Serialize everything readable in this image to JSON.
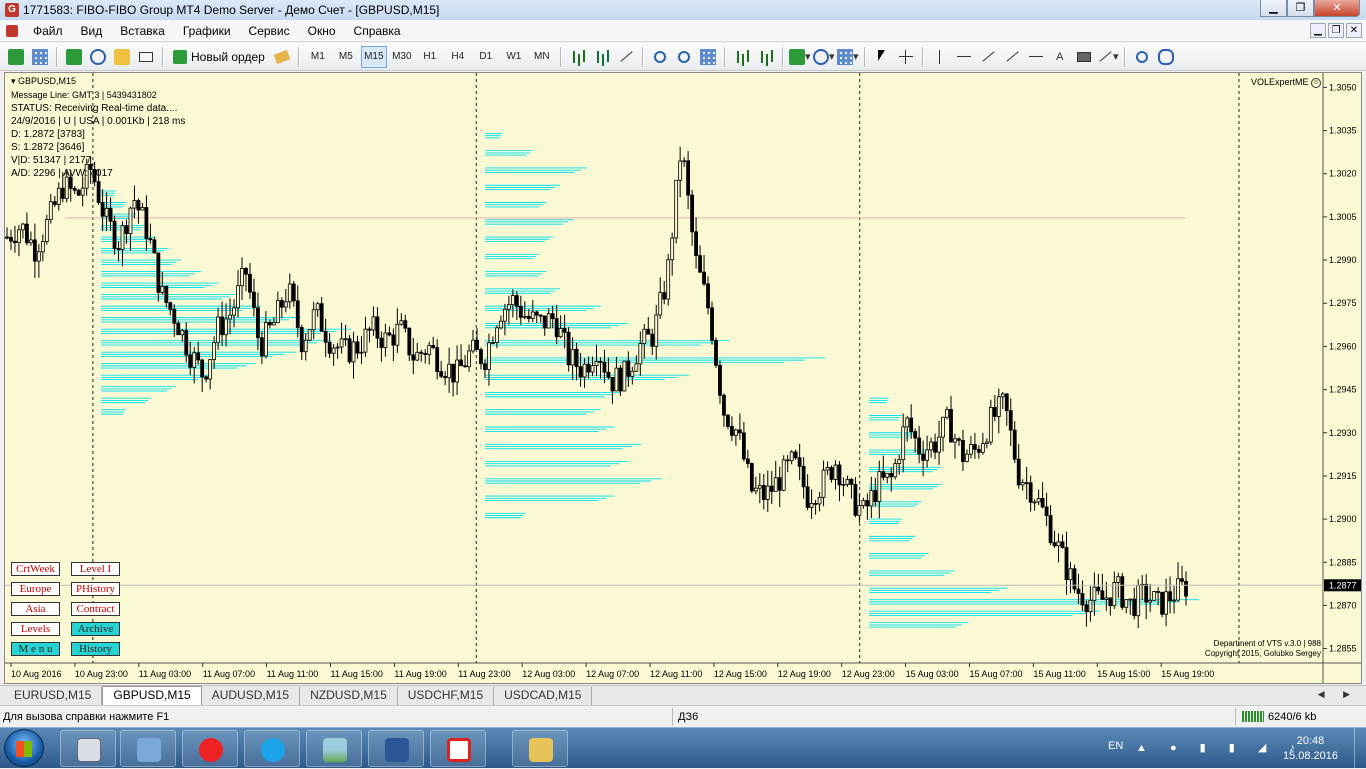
{
  "window": {
    "title": "1771583: FIBO-FIBO Group MT4 Demo Server - Демо Счет - [GBPUSD,M15]",
    "min": "▁",
    "max": "❐",
    "close": "✕"
  },
  "menu": [
    "Файл",
    "Вид",
    "Вставка",
    "Графики",
    "Сервис",
    "Окно",
    "Справка"
  ],
  "toolbar": {
    "new_order": "Новый ордер",
    "timeframes": [
      "M1",
      "M5",
      "M15",
      "M30",
      "H1",
      "H4",
      "D1",
      "W1",
      "MN"
    ],
    "active_timeframe": "M15",
    "text_tool": "A"
  },
  "chart": {
    "symbol": "GBPUSD,M15",
    "info": [
      "Message Line: GMT 3 | 5439431802",
      "STATUS:  Receiving Real-time data....",
      "24/9/2016 | U | USA | 0.001Kb | 218 ms",
      "D: 1.2872  [3783]",
      "S: 1.2872  [3646]",
      "V|D: 51347 | 2177",
      "A/D: 2296 | AVW: 4017"
    ],
    "expert": "VOLExpertME",
    "expert_smile": "☺",
    "dept_line1": "Department of VTS  v.3.0 | 988",
    "dept_line2": "Copyright 2015, Golubko Sergey",
    "current_price": "1.2877",
    "buttons": [
      {
        "label": "CrtWeek",
        "style": "white"
      },
      {
        "label": "Level I",
        "style": "white"
      },
      {
        "label": "Europe",
        "style": "white"
      },
      {
        "label": "PHistory",
        "style": "white"
      },
      {
        "label": "Asia",
        "style": "white"
      },
      {
        "label": "Contract",
        "style": "white"
      },
      {
        "label": "Levels",
        "style": "white"
      },
      {
        "label": "Archive",
        "style": "cyan"
      },
      {
        "label": "M e n u",
        "style": "cyan"
      },
      {
        "label": "History",
        "style": "cyan"
      }
    ],
    "colors": {
      "background": "#fbf9d3",
      "candle": "#000000",
      "profile": "#00e0f0",
      "price_line": "#bdbdbd"
    }
  },
  "chart_data": {
    "type": "candlestick",
    "title": "",
    "y_ticks": [
      "1.3050",
      "1.3035",
      "1.3020",
      "1.3005",
      "1.2990",
      "1.2975",
      "1.2960",
      "1.2945",
      "1.2930",
      "1.2915",
      "1.2900",
      "1.2885",
      "1.2870",
      "1.2855"
    ],
    "ylim": [
      1.285,
      1.3055
    ],
    "x_ticks": [
      "10 Aug 2016",
      "10 Aug 23:00",
      "11 Aug 03:00",
      "11 Aug 07:00",
      "11 Aug 11:00",
      "11 Aug 15:00",
      "11 Aug 19:00",
      "11 Aug 23:00",
      "12 Aug 03:00",
      "12 Aug 07:00",
      "12 Aug 11:00",
      "12 Aug 15:00",
      "12 Aug 19:00",
      "12 Aug 23:00",
      "15 Aug 03:00",
      "15 Aug 07:00",
      "15 Aug 11:00",
      "15 Aug 15:00",
      "15 Aug 19:00"
    ],
    "close_path": [
      1.2998,
      1.3002,
      1.2994,
      1.3004,
      1.3016,
      1.3012,
      1.3022,
      1.3004,
      1.2996,
      1.3012,
      1.3,
      1.2978,
      1.297,
      1.2958,
      1.295,
      1.2966,
      1.2972,
      1.2986,
      1.296,
      1.2968,
      1.298,
      1.2962,
      1.2972,
      1.2962,
      1.2958,
      1.296,
      1.2966,
      1.2962,
      1.2966,
      1.2956,
      1.296,
      1.2954,
      1.295,
      1.2958,
      1.2956,
      1.2972,
      1.2976,
      1.297,
      1.2968,
      1.297,
      1.2956,
      1.2952,
      1.296,
      1.2948,
      1.295,
      1.296,
      1.2964,
      1.2984,
      1.303,
      1.299,
      1.2972,
      1.2938,
      1.293,
      1.291,
      1.2908,
      1.2914,
      1.292,
      1.2908,
      1.2912,
      1.292,
      1.2908,
      1.2902,
      1.2912,
      1.2914,
      1.2934,
      1.2924,
      1.2926,
      1.2934,
      1.2922,
      1.2924,
      1.2934,
      1.294,
      1.2916,
      1.291,
      1.29,
      1.2888,
      1.2876,
      1.2872,
      1.2872,
      1.2876,
      1.287,
      1.2874,
      1.287,
      1.2874,
      1.2877
    ],
    "profiles": [
      {
        "period": "11 Aug",
        "price_levels": [
          1.3014,
          1.301,
          1.3006,
          1.3002,
          1.2998,
          1.2994,
          1.299,
          1.2986,
          1.2982,
          1.2978,
          1.2974,
          1.297,
          1.2966,
          1.2962,
          1.2958,
          1.2954,
          1.295,
          1.2946,
          1.2942,
          1.2938
        ],
        "volumes": [
          6,
          10,
          14,
          18,
          22,
          27,
          32,
          40,
          47,
          55,
          64,
          80,
          100,
          92,
          78,
          62,
          44,
          30,
          20,
          10
        ]
      },
      {
        "period": "12 Aug",
        "price_levels": [
          1.3034,
          1.3028,
          1.3022,
          1.3016,
          1.301,
          1.3004,
          1.2998,
          1.2992,
          1.2986,
          1.298,
          1.2974,
          1.2968,
          1.2962,
          1.2956,
          1.295,
          1.2944,
          1.2938,
          1.2932,
          1.2926,
          1.292,
          1.2914,
          1.2908,
          1.2902
        ],
        "volumes": [
          5,
          14,
          30,
          22,
          18,
          26,
          20,
          16,
          18,
          22,
          34,
          42,
          72,
          100,
          60,
          40,
          34,
          38,
          46,
          42,
          52,
          38,
          12
        ]
      },
      {
        "period": "15 Aug",
        "price_levels": [
          1.2942,
          1.2936,
          1.293,
          1.2924,
          1.2918,
          1.2912,
          1.2906,
          1.29,
          1.2894,
          1.2888,
          1.2882,
          1.2876,
          1.2872,
          1.2868,
          1.2864
        ],
        "volumes": [
          6,
          10,
          14,
          18,
          22,
          22,
          16,
          10,
          14,
          18,
          26,
          42,
          100,
          70,
          30
        ]
      }
    ]
  },
  "tabs": [
    "EURUSD,M15",
    "GBPUSD,M15",
    "AUDUSD,M15",
    "NZDUSD,M15",
    "USDCHF,M15",
    "USDCAD,M15"
  ],
  "active_tab": "GBPUSD,M15",
  "tab_arrows": "◀ ▶",
  "status": {
    "help": "Для вызова справки нажмите F1",
    "profile": "ДЗ6",
    "traffic": "6240/6 kb"
  },
  "taskbar": {
    "lang": "EN",
    "time": "20:48",
    "date": "15.08.2016",
    "apps": [
      "calculator",
      "computer",
      "yandex",
      "skype",
      "photos",
      "word",
      "fibo",
      "explorer"
    ]
  }
}
